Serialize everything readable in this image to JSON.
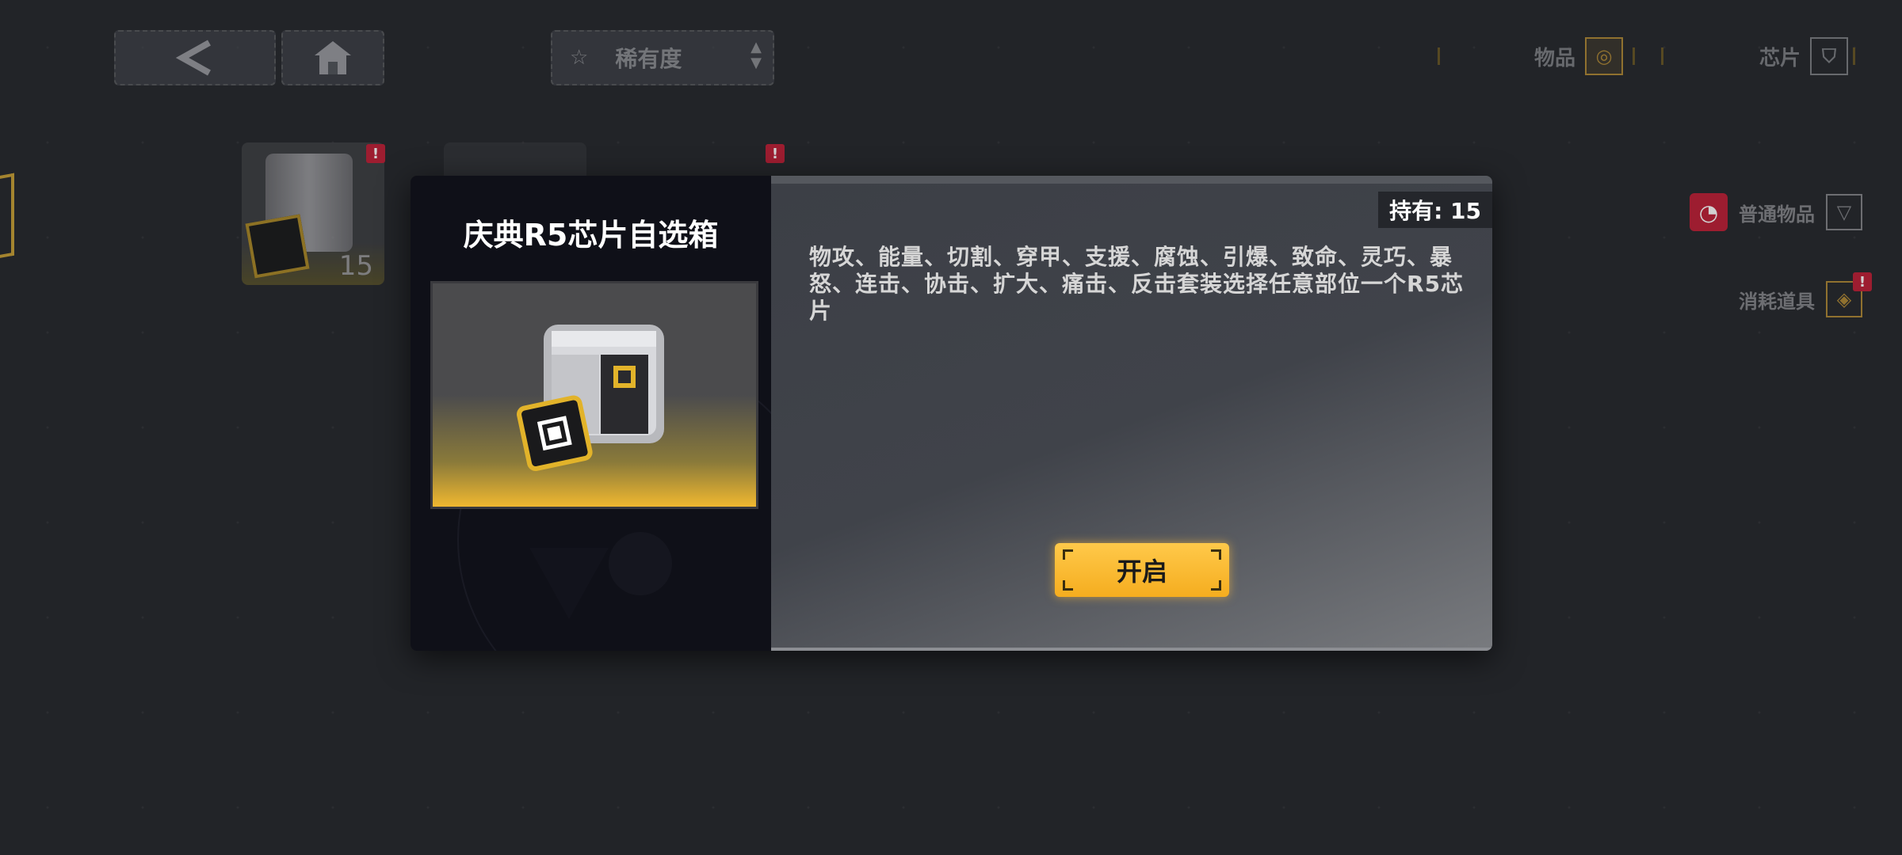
{
  "topbar": {
    "sort_label": "稀有度",
    "tab_items_label": "物品",
    "tab_chips_label": "芯片"
  },
  "side": {
    "normal_items_label": "普通物品",
    "consumables_label": "消耗道具"
  },
  "grid": {
    "item1_count": "15"
  },
  "modal": {
    "title": "庆典R5芯片自选箱",
    "hold_text": "持有: 15",
    "description": "物攻、能量、切割、穿甲、支援、腐蚀、引爆、致命、灵巧、暴怒、连击、协击、扩大、痛击、反击套装选择任意部位一个R5芯片",
    "open_label": "开启"
  },
  "colors": {
    "accent": "#f5ad1f",
    "badge": "#c0243b"
  }
}
